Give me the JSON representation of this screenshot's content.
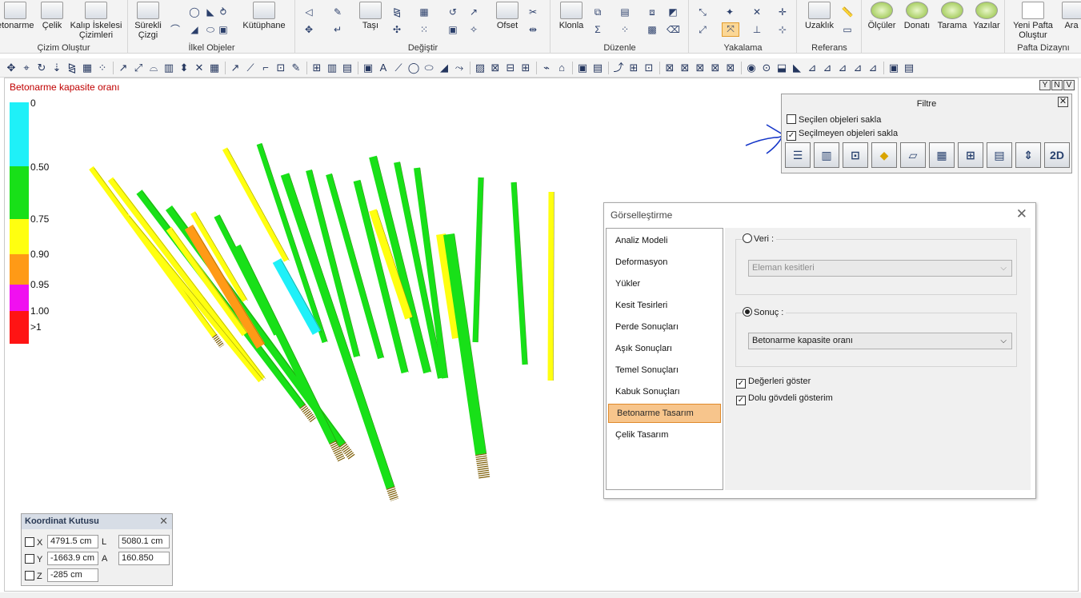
{
  "ribbon": {
    "groups": [
      {
        "title": "Çizim Oluştur",
        "buttons": [
          "etonarme",
          "Çelik",
          "Kalıp İskelesi Çizimleri"
        ]
      },
      {
        "title": "İlkel Objeler",
        "buttons": [
          "Sürekli Çizgi",
          "Kütüphane"
        ]
      },
      {
        "title": "Değiştir",
        "buttons": [
          "Taşı",
          "Ofset"
        ]
      },
      {
        "title": "Düzenle",
        "buttons": [
          "Klonla"
        ]
      },
      {
        "title": "Yakalama",
        "buttons": []
      },
      {
        "title": "Referans",
        "buttons": [
          "Uzaklık"
        ]
      },
      {
        "title": "",
        "buttons": [
          "Ölçüler",
          "Donatı",
          "Tarama",
          "Yazılar"
        ]
      },
      {
        "title": "Pafta Dizaynı",
        "buttons": [
          "Yeni Pafta Oluştur",
          "Ara"
        ]
      }
    ]
  },
  "viewport": {
    "title": "Betonarme kapasite oranı",
    "controls": [
      "Y",
      "N",
      "V"
    ]
  },
  "legend": {
    "labels": [
      "0",
      "0.50",
      "0.75",
      "0.90",
      "0.95",
      "1.00",
      ">1"
    ],
    "colors": {
      "cyan": "#1ff0f8",
      "green": "#18e018",
      "yellow": "#ffff10",
      "orange": "#ff9a16",
      "magenta": "#f010f0",
      "red": "#ff1414"
    }
  },
  "filtre": {
    "title": "Filtre",
    "option1": "Seçilen objeleri sakla",
    "option2": "Seçilmeyen objeleri sakla",
    "option1_checked": false,
    "option2_checked": true,
    "buttons": [
      "2D"
    ]
  },
  "gorsel": {
    "title": "Görselleştirme",
    "menu": [
      "Analiz Modeli",
      "Deformasyon",
      "Yükler",
      "Kesit Tesirleri",
      "Perde Sonuçları",
      "Aşık Sonuçları",
      "Temel Sonuçları",
      "Kabuk Sonuçları",
      "Betonarme Tasarım",
      "Çelik Tasarım"
    ],
    "active_index": 8,
    "veri_label": "Veri :",
    "veri_value": "Eleman kesitleri",
    "sonuc_label": "Sonuç :",
    "sonuc_value": "Betonarme kapasite oranı",
    "show_values": "Değerleri göster",
    "solid_view": "Dolu gövdeli gösterim",
    "show_values_checked": true,
    "solid_view_checked": true
  },
  "coord": {
    "title": "Koordinat Kutusu",
    "x_label": "X",
    "y_label": "Y",
    "z_label": "Z",
    "x": "4791.5 cm",
    "y": "-1663.9 cm",
    "z": "-285 cm",
    "l_label": "L",
    "a_label": "A",
    "l": "5080.1 cm",
    "a": "160.850"
  }
}
